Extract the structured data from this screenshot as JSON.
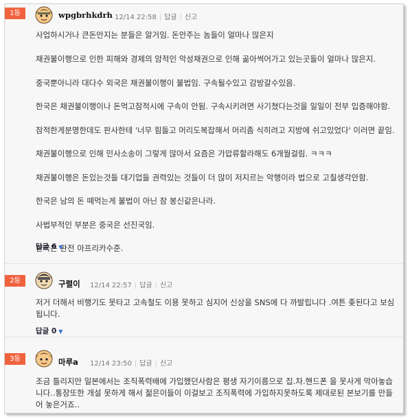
{
  "comments": [
    {
      "rank": "1등",
      "username": "wpgbrhkdrh",
      "timestamp": "12/14 22:58",
      "reply_label": "답글",
      "report_label": "신고",
      "paragraphs": [
        "사업하시거나 큰돈만지는 분들은 알거임. 돈안주는 놈들이 얼마나 많은지",
        "채권불이행으로 인한 피해와 경제의 암적인 악성채권으로 인해 곪아썩어가고 있는곳들이 얼마나 많은지.",
        "중국뿐아니라 대다수 외국은 채권불이행이 불법임. 구속될수있고 감방갈수있음.",
        "한국은 채권불이행이나 돈먹고잠적시에 구속이 안됨. 구속시키려면 사기쳤다는것을 일일이 전부 입증해야함.",
        "잠적한게분명한데도 판사한테 '너무 힘들고 머리도복잡해서 머리좀 식히려고 지방에 쉬고있었다' 이러면 끝임.",
        "채권불이행으로 인해 민사소송이 그렇게 많아서 요즘은 가압류할라해도 6개월걸림. ㅋㅋㅋ",
        "채권불이행은 돈있는것들 대기업들 권력있는 것들이 더 많이 저지르는 악행이라 법으로 고칠생각안함.",
        "한국은 남의 돈 떼먹는게 불법이 아닌 참 봉신같은나라.",
        "사법부적인 부분은 중국은 선진국임.",
        "한국은 완전 아프리카수준."
      ],
      "reply_count_label": "답글 6"
    },
    {
      "rank": "2등",
      "username": "구렬이",
      "timestamp": "12/14 22:57",
      "reply_label": "답글",
      "report_label": "신고",
      "paragraphs": [
        "저거 더해서 비행기도 못타고 고속철도 이용 못하고 심지어 신상을 SNS에 다 까발립니다 .여튼 좆된다고 보심됩니다."
      ],
      "reply_count_label": "답글 0"
    },
    {
      "rank": "3등",
      "username": "마루a",
      "timestamp": "12/14 23:50",
      "reply_label": "답글",
      "report_label": "신고",
      "paragraphs": [
        "조금 틀리지만 일본에서는 조직폭력배에 가입했던사람은 평생 자기이름으로 집.차.핸드폰 을 못사게 막아놓습니다..통장또한 개설 못하게 해서 젊은이들이 이걸보고 조직폭력에 가입하지못하도록 제대로된 본보기를 만들어 놓은거죠.."
      ]
    }
  ],
  "colors": {
    "rank_badge": "#f1623f",
    "reply_caret": "#3b6fd1"
  }
}
